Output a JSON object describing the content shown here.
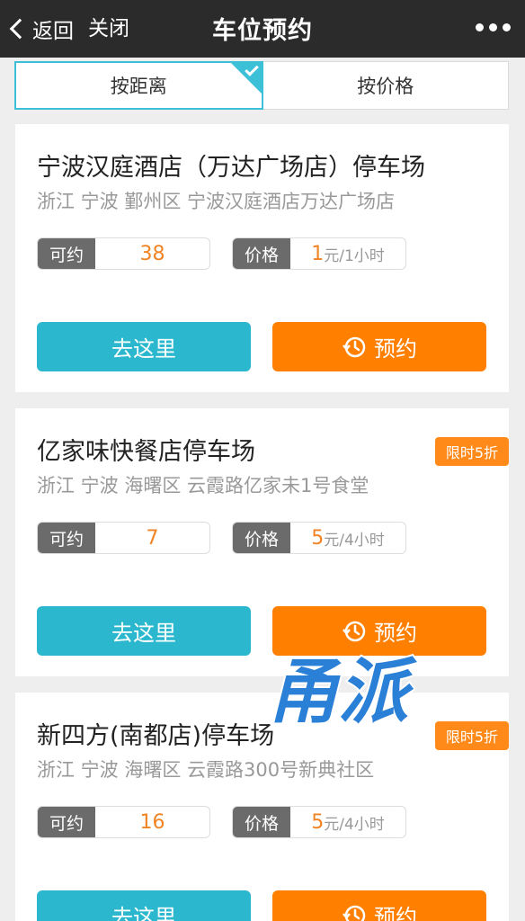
{
  "nav": {
    "back_label": "返回",
    "close_label": "关闭",
    "title": "车位预约"
  },
  "tabs": [
    {
      "label": "按距离",
      "active": true
    },
    {
      "label": "按价格",
      "active": false
    }
  ],
  "stat_labels": {
    "available": "可约",
    "price": "价格"
  },
  "buttons": {
    "go": "去这里",
    "book": "预约"
  },
  "cards": [
    {
      "name": "宁波汉庭酒店（万达广场店）停车场",
      "address": "浙江 宁波 鄞州区 宁波汉庭酒店万达广场店",
      "available": "38",
      "price_amount": "1",
      "price_unit": "元/1小时",
      "promo": ""
    },
    {
      "name": "亿家味快餐店停车场",
      "address": "浙江 宁波 海曙区 云霞路亿家未1号食堂",
      "available": "7",
      "price_amount": "5",
      "price_unit": "元/4小时",
      "promo": "限时5折"
    },
    {
      "name": "新四方(南都店)停车场",
      "address": "浙江 宁波 海曙区 云霞路300号新典社区",
      "available": "16",
      "price_amount": "5",
      "price_unit": "元/4小时",
      "promo": "限时5折"
    }
  ],
  "watermark_text": "甬派",
  "colors": {
    "navbar": "#2b2b2b",
    "accent_teal": "#2bb8cf",
    "accent_orange": "#ff7f00",
    "value_orange": "#f08324",
    "watermark_blue": "#2a7fd6"
  }
}
